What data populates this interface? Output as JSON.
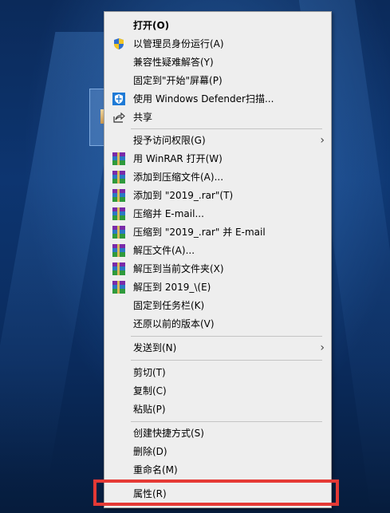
{
  "context_menu": {
    "items": [
      {
        "label": "打开(O)",
        "bold": true,
        "icon": "",
        "submenu": false
      },
      {
        "label": "以管理员身份运行(A)",
        "icon": "uac-shield-icon",
        "submenu": false
      },
      {
        "label": "兼容性疑难解答(Y)",
        "icon": "",
        "submenu": false
      },
      {
        "label": "固定到\"开始\"屏幕(P)",
        "icon": "",
        "submenu": false
      },
      {
        "label": "使用 Windows Defender扫描...",
        "icon": "windows-defender-icon",
        "submenu": false
      },
      {
        "label": "共享",
        "icon": "share-icon",
        "submenu": false
      },
      {
        "label": "授予访问权限(G)",
        "icon": "",
        "submenu": true
      },
      {
        "label": "用 WinRAR 打开(W)",
        "icon": "winrar-icon",
        "submenu": false
      },
      {
        "label": "添加到压缩文件(A)...",
        "icon": "winrar-icon",
        "submenu": false
      },
      {
        "label": "添加到 \"2019_.rar\"(T)",
        "icon": "winrar-icon",
        "submenu": false
      },
      {
        "label": "压缩并 E-mail...",
        "icon": "winrar-icon",
        "submenu": false
      },
      {
        "label": "压缩到 \"2019_.rar\" 并 E-mail",
        "icon": "winrar-icon",
        "submenu": false
      },
      {
        "label": "解压文件(A)...",
        "icon": "winrar-icon",
        "submenu": false
      },
      {
        "label": "解压到当前文件夹(X)",
        "icon": "winrar-icon",
        "submenu": false
      },
      {
        "label": "解压到 2019_\\(E)",
        "icon": "winrar-icon",
        "submenu": false
      },
      {
        "label": "固定到任务栏(K)",
        "icon": "",
        "submenu": false
      },
      {
        "label": "还原以前的版本(V)",
        "icon": "",
        "submenu": false
      },
      {
        "label": "发送到(N)",
        "icon": "",
        "submenu": true
      },
      {
        "label": "剪切(T)",
        "icon": "",
        "submenu": false
      },
      {
        "label": "复制(C)",
        "icon": "",
        "submenu": false
      },
      {
        "label": "粘贴(P)",
        "icon": "",
        "submenu": false
      },
      {
        "label": "创建快捷方式(S)",
        "icon": "",
        "submenu": false
      },
      {
        "label": "删除(D)",
        "icon": "",
        "submenu": false
      },
      {
        "label": "重命名(M)",
        "icon": "",
        "submenu": false
      },
      {
        "label": "属性(R)",
        "icon": "",
        "submenu": false
      }
    ],
    "submenu_arrow": "›"
  },
  "colors": {
    "menu_background": "#eeeeee",
    "highlight_border": "#e53935"
  }
}
